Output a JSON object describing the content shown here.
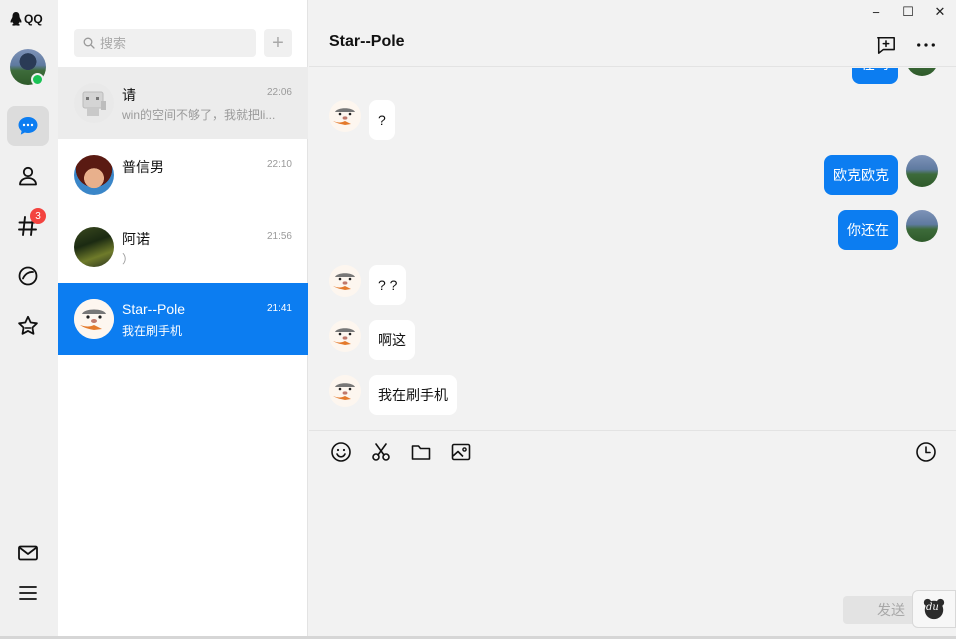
{
  "app": {
    "title": "QQ"
  },
  "nav": {
    "items": [
      {
        "name": "messages",
        "active": true
      },
      {
        "name": "contacts"
      },
      {
        "name": "channels",
        "badge": "3"
      },
      {
        "name": "discover"
      },
      {
        "name": "favorites"
      },
      {
        "name": "mail"
      },
      {
        "name": "menu"
      }
    ]
  },
  "search": {
    "placeholder": "搜索",
    "add_label": "+"
  },
  "conversations": [
    {
      "name": "请",
      "time": "22:06",
      "preview": "win的空间不够了，我就把li...",
      "avatar": "robot-icon"
    },
    {
      "name": "普信男",
      "time": "22:10",
      "preview": "",
      "avatar": "anime-avatar"
    },
    {
      "name": "阿诺",
      "time": "21:56",
      "preview": "）",
      "avatar": "scene-avatar"
    },
    {
      "name": "Star--Pole",
      "time": "21:41",
      "preview": "我在刷手机",
      "avatar": "mole-avatar",
      "selected": true
    }
  ],
  "chat": {
    "title": "Star--Pole",
    "messages": [
      {
        "from": "me",
        "text": "在吗",
        "partial": true
      },
      {
        "from": "them",
        "text": "?"
      },
      {
        "from": "me",
        "text": "欧克欧克"
      },
      {
        "from": "me",
        "text": "你还在"
      },
      {
        "from": "them",
        "text": "? ?"
      },
      {
        "from": "them",
        "text": "啊这"
      },
      {
        "from": "them",
        "text": "我在刷手机"
      }
    ],
    "send_label": "发送",
    "input_value": ""
  },
  "window": {
    "minimize": "−",
    "maximize": "☐",
    "close": "✕"
  },
  "floating": {
    "label": "du"
  },
  "colors": {
    "accent": "#0c7df1",
    "online": "#19c254",
    "badge": "#f3433f"
  }
}
